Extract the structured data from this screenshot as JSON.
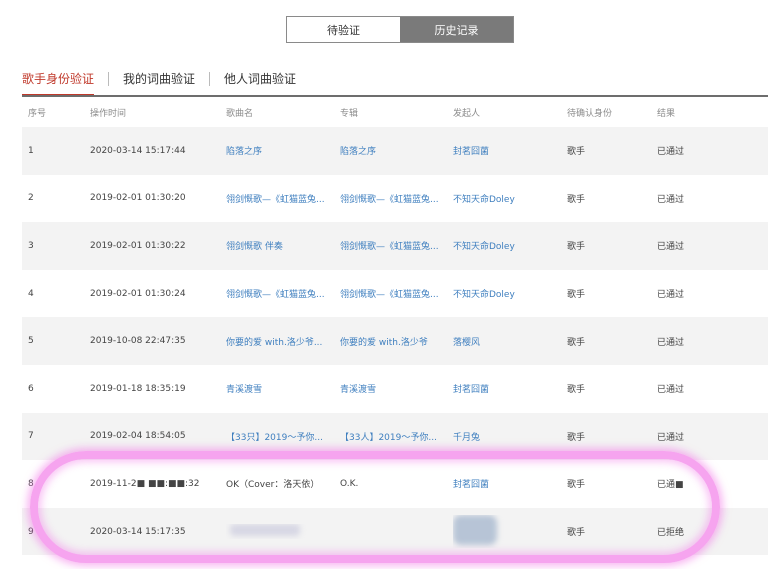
{
  "segmented": [
    "待验证",
    "历史记录"
  ],
  "tabs": [
    "歌手身份验证",
    "我的词曲验证",
    "他人词曲验证"
  ],
  "columns": [
    "序号",
    "操作时间",
    "歌曲名",
    "专辑",
    "发起人",
    "待确认身份",
    "结果"
  ],
  "rows": [
    {
      "no": "1",
      "time": "2020-03-14 15:17:44",
      "song": "陷落之序",
      "album": "陷落之序",
      "initiator": "封茗囧菌",
      "role": "歌手",
      "result": "已通过"
    },
    {
      "no": "2",
      "time": "2019-02-01 01:30:20",
      "song": "翎剑慨歌—《虹猫蓝兔...",
      "album": "翎剑慨歌—《虹猫蓝兔...",
      "initiator": "不知天命Doley",
      "role": "歌手",
      "result": "已通过"
    },
    {
      "no": "3",
      "time": "2019-02-01 01:30:22",
      "song": "翎剑慨歌 伴奏",
      "album": "翎剑慨歌—《虹猫蓝兔...",
      "initiator": "不知天命Doley",
      "role": "歌手",
      "result": "已通过"
    },
    {
      "no": "4",
      "time": "2019-02-01 01:30:24",
      "song": "翎剑慨歌—《虹猫蓝兔...",
      "album": "翎剑慨歌—《虹猫蓝兔...",
      "initiator": "不知天命Doley",
      "role": "歌手",
      "result": "已通过"
    },
    {
      "no": "5",
      "time": "2019-10-08 22:47:35",
      "song": "你要的爱 with.洛少爷...",
      "album": "你要的爱 with.洛少爷",
      "initiator": "落樱风",
      "role": "歌手",
      "result": "已通过"
    },
    {
      "no": "6",
      "time": "2019-01-18 18:35:19",
      "song": "青溪渡雪",
      "album": "青溪渡雪",
      "initiator": "封茗囧菌",
      "role": "歌手",
      "result": "已通过"
    },
    {
      "no": "7",
      "time": "2019-02-04 18:54:05",
      "song": "【33只】2019～予你...",
      "album": "【33人】2019～予你...",
      "initiator": "千月兔",
      "role": "歌手",
      "result": "已通过"
    },
    {
      "no": "8",
      "time": "2019-11-2■ ■■:■■:32",
      "song": "OK（Cover：洛天依）",
      "album": "O.K.",
      "initiator": "封茗囧菌",
      "role": "歌手",
      "result": "已通■"
    },
    {
      "no": "9",
      "time": "2020-03-14 15:17:35",
      "song": "",
      "album": "",
      "initiator": "",
      "role": "歌手",
      "result": "已拒绝"
    }
  ]
}
